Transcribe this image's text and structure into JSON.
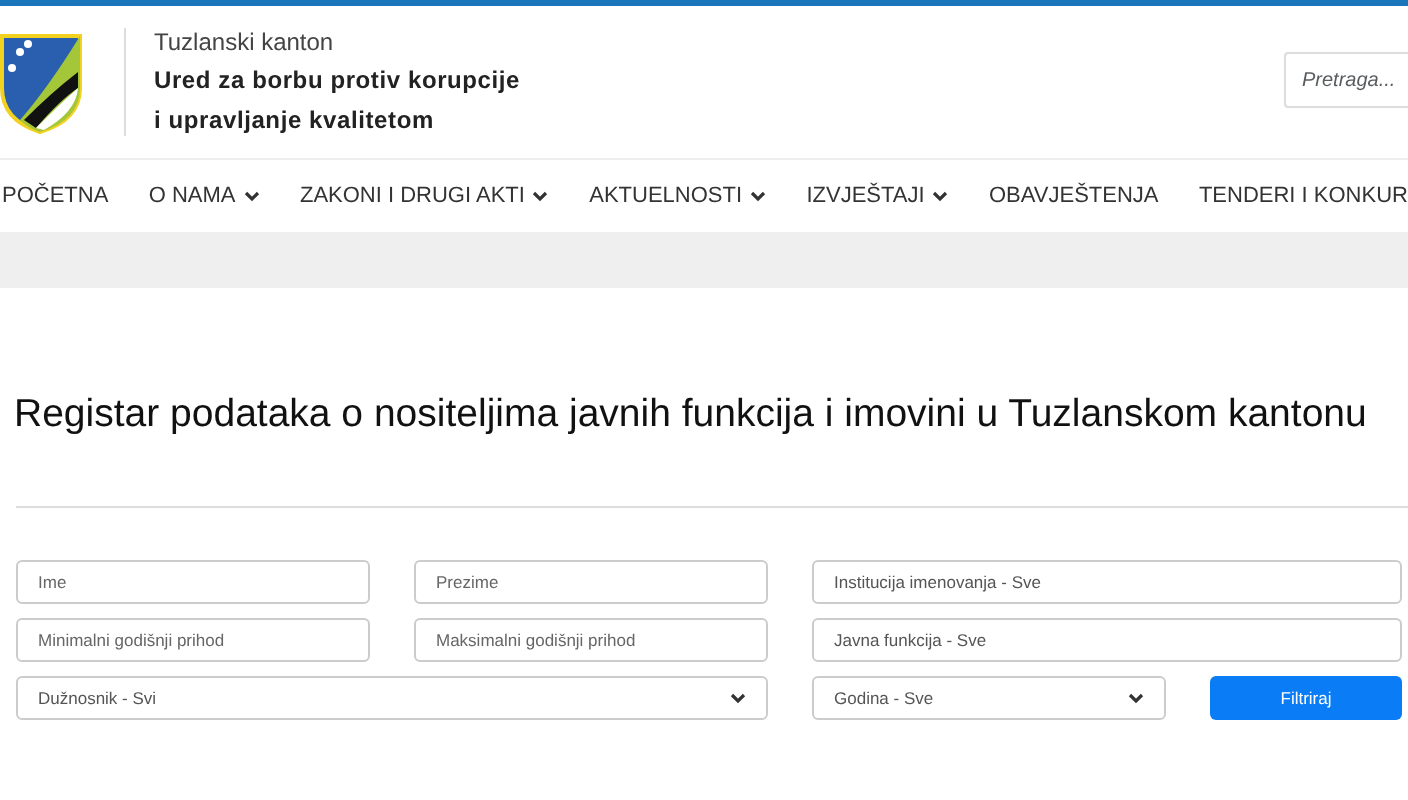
{
  "header": {
    "region": "Tuzlanski kanton",
    "office": [
      "Ured za borbu protiv korupcije",
      "i upravljanje kvalitetom"
    ],
    "search": {
      "placeholder": "Pretraga..."
    }
  },
  "nav": [
    {
      "label": "POČETNA",
      "dropdown": false
    },
    {
      "label": "O NAMA",
      "dropdown": true
    },
    {
      "label": "ZAKONI I DRUGI AKTI",
      "dropdown": true
    },
    {
      "label": "AKTUELNOSTI",
      "dropdown": true
    },
    {
      "label": "IZVJEŠTAJI",
      "dropdown": true
    },
    {
      "label": "OBAVJEŠTENJA",
      "dropdown": false
    },
    {
      "label": "TENDERI I KONKUR",
      "dropdown": false
    }
  ],
  "title": "Registar podataka o nositeljima javnih funkcija i imovini u Tuzlanskom kantonu",
  "filter_rows": [
    [
      {
        "kind": "text",
        "placeholder": "Ime"
      },
      {
        "kind": "text",
        "placeholder": "Prezime"
      },
      {
        "kind": "combo",
        "value": "Institucija imenovanja - Sve"
      }
    ],
    [
      {
        "kind": "text",
        "placeholder": "Minimalni godišnji prihod"
      },
      {
        "kind": "text",
        "placeholder": "Maksimalni godišnji prihod"
      },
      {
        "kind": "combo",
        "value": "Javna funkcija - Sve"
      }
    ],
    [
      {
        "kind": "select",
        "value": "Dužnosnik - Svi"
      },
      {
        "kind": "select",
        "value": "Godina - Sve"
      },
      {
        "kind": "button",
        "label": "Filtriraj"
      }
    ]
  ]
}
